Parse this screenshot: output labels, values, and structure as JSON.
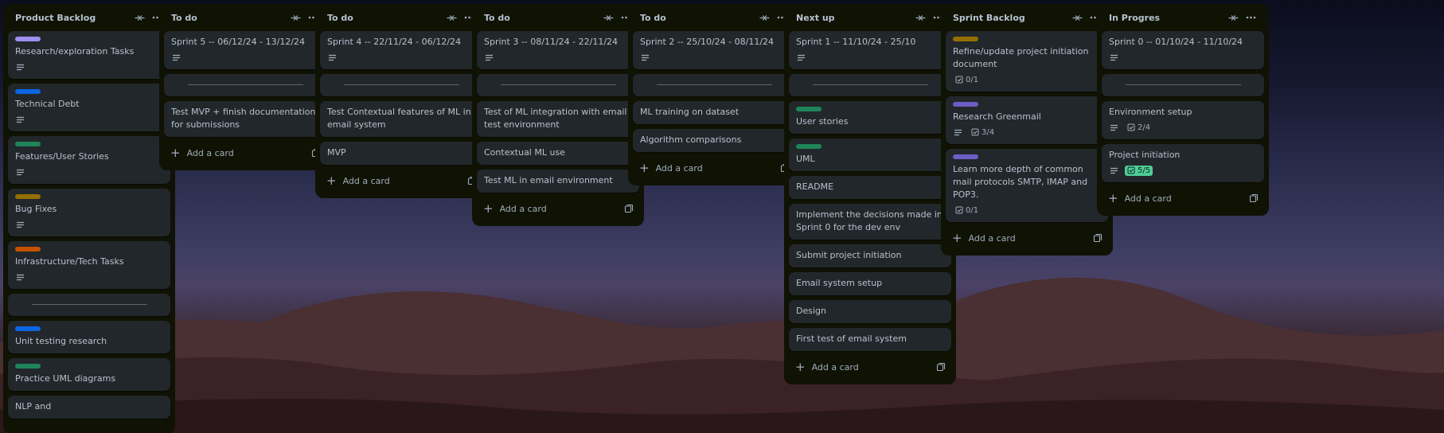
{
  "board": {
    "add_card_label": "Add a card",
    "lists": [
      {
        "title": "Product Backlog",
        "cards": [
          {
            "label": "#9f8fef",
            "title": "Research/exploration Tasks",
            "desc": true
          },
          {
            "label": "#0c66e4",
            "title": "Technical Debt",
            "desc": true
          },
          {
            "label": "#1f845a",
            "title": "Features/User Stories",
            "desc": true
          },
          {
            "label": "#946f00",
            "title": "Bug Fixes",
            "desc": true
          },
          {
            "label": "#c25100",
            "title": "Infrastructure/Tech Tasks",
            "desc": true
          },
          {
            "separator": true
          },
          {
            "label": "#0c66e4",
            "title": "Unit testing research"
          },
          {
            "label": "#1f845a",
            "title": "Practice UML diagrams"
          },
          {
            "title": "NLP and"
          }
        ]
      },
      {
        "title": "To do",
        "cards": [
          {
            "title": "Sprint 5 -- 06/12/24 - 13/12/24",
            "desc": true
          },
          {
            "separator": true
          },
          {
            "title": "Test MVP + finish documentation for submissions"
          }
        ],
        "add": true
      },
      {
        "title": "To do",
        "cards": [
          {
            "title": "Sprint 4 -- 22/11/24 - 06/12/24",
            "desc": true
          },
          {
            "separator": true
          },
          {
            "title": "Test Contextual features of ML in email system"
          },
          {
            "title": "MVP"
          }
        ],
        "add": true
      },
      {
        "title": "To do",
        "cards": [
          {
            "title": "Sprint 3 -- 08/11/24 - 22/11/24",
            "desc": true
          },
          {
            "separator": true
          },
          {
            "title": "Test of ML integration with email test environment"
          },
          {
            "title": "Contextual ML use"
          },
          {
            "title": "Test ML in email environment"
          }
        ],
        "add": true
      },
      {
        "title": "To do",
        "cards": [
          {
            "title": "Sprint 2 -- 25/10/24 - 08/11/24",
            "desc": true
          },
          {
            "separator": true
          },
          {
            "title": "ML training on dataset"
          },
          {
            "title": "Algorithm comparisons"
          }
        ],
        "add": true
      },
      {
        "title": "Next up",
        "cards": [
          {
            "title": "Sprint 1 -- 11/10/24 - 25/10",
            "desc": true
          },
          {
            "separator": true
          },
          {
            "label": "#1f845a",
            "title": "User stories"
          },
          {
            "label": "#1f845a",
            "title": "UML"
          },
          {
            "title": "README"
          },
          {
            "title": "Implement the decisions made in Sprint 0 for the dev env"
          },
          {
            "title": "Submit project initiation"
          },
          {
            "title": "Email system setup"
          },
          {
            "title": "Design"
          },
          {
            "title": "First test of email system"
          }
        ],
        "add": true
      },
      {
        "title": "Sprint Backlog",
        "cards": [
          {
            "label": "#946f00",
            "title": "Refine/update project initiation document",
            "check": "0/1"
          },
          {
            "label": "#6e5dc6",
            "title": "Research Greenmail",
            "desc": true,
            "check": "3/4"
          },
          {
            "label": "#6e5dc6",
            "title": "Learn more depth of common mail protocols SMTP, IMAP and POP3.",
            "check": "0/1"
          }
        ],
        "add": true
      },
      {
        "title": "In Progres",
        "cards": [
          {
            "title": "Sprint 0 -- 01/10/24 - 11/10/24",
            "desc": true
          },
          {
            "separator": true
          },
          {
            "title": "Environment setup",
            "desc": true,
            "check": "2/4"
          },
          {
            "title": "Project initiation",
            "desc": true,
            "check": "5/5",
            "check_done": true
          }
        ],
        "add": true
      }
    ]
  },
  "icons": {
    "collapse": "collapse-icon",
    "menu": "more-icon",
    "description": "description-icon",
    "checklist": "checklist-icon",
    "template": "template-icon"
  }
}
